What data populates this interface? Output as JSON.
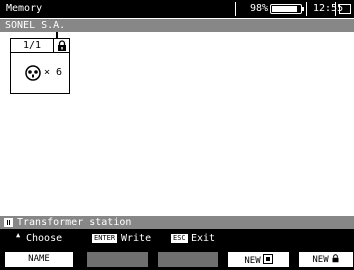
{
  "titlebar": {
    "title": "Memory",
    "battery_text": "98%",
    "battery_level": 0.98,
    "clock": "12:55"
  },
  "header": {
    "text": "SONEL S.A."
  },
  "card": {
    "page": "1/1",
    "count": "× 6",
    "icon": "socket-icon",
    "lock_icon": "lock-icon"
  },
  "status": {
    "text": "Transformer station"
  },
  "hints": {
    "choose": "Choose",
    "enter_key": "ENTER",
    "write": "Write",
    "esc_key": "ESC",
    "exit": "Exit"
  },
  "fkeys": {
    "f1": "NAME",
    "f2": "",
    "f3": "",
    "f4": "NEW",
    "f5": "NEW"
  },
  "colors": {
    "bar_gray": "#878787",
    "disabled_key": "#6f6f6f"
  }
}
